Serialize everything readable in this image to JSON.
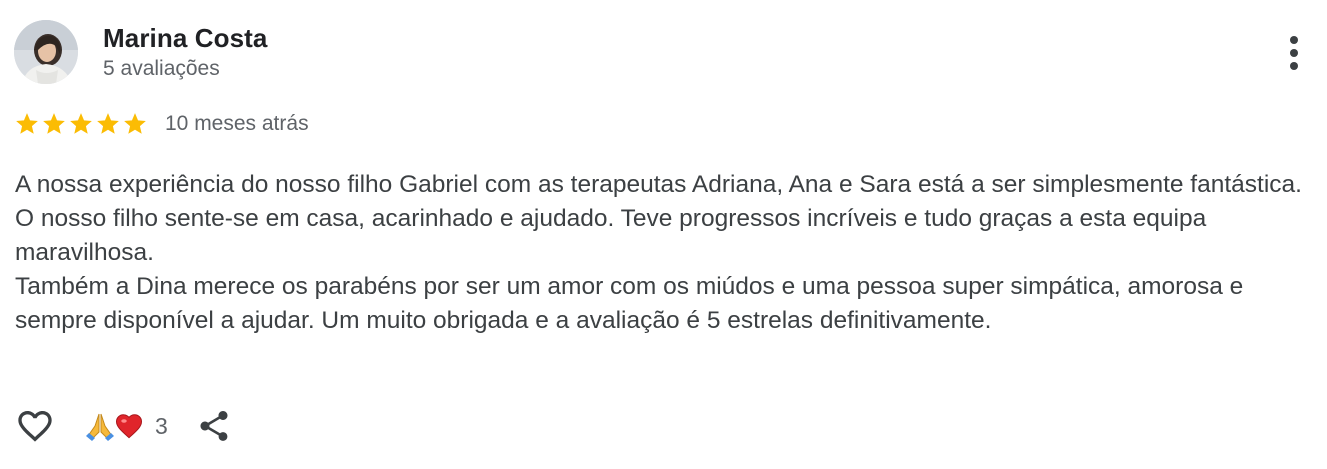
{
  "review": {
    "author": {
      "name": "Marina Costa",
      "meta": "5 avaliações",
      "avatar_icon": "user-avatar-photo"
    },
    "rating": {
      "stars": 5,
      "max_stars": 5,
      "star_color": "#fbbc04"
    },
    "date": "10 meses atrás",
    "text": {
      "paragraph_1": "A nossa experiência do nosso filho Gabriel com as terapeutas Adriana, Ana e Sara está a ser simplesmente fantástica. O nosso filho sente-se em casa, acarinhado e ajudado. Teve progressos incríveis e tudo graças a esta equipa maravilhosa.",
      "paragraph_2": "Também a Dina merece os parabéns por ser um amor com os miúdos e uma pessoa super simpática, amorosa e sempre disponível a ajudar. Um muito obrigada e a avaliação é 5 estrelas definitivamente."
    },
    "actions": {
      "like_icon": "heart-outline-icon",
      "reaction_icons": [
        "praying-hands-icon",
        "red-heart-icon"
      ],
      "reaction_count": "3",
      "share_icon": "share-icon"
    },
    "menu_icon": "more-vert-icon"
  }
}
